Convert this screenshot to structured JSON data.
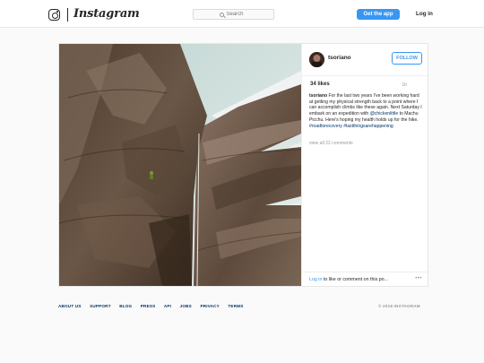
{
  "header": {
    "brand": "Instagram",
    "search_placeholder": "Search",
    "get_app_label": "Get the app",
    "login_label": "Log in"
  },
  "post": {
    "username": "tsoriano",
    "follow_label": "FOLLOW",
    "likes": "34 likes",
    "age": "1h",
    "caption": {
      "username": "tsoriano",
      "text_1": " For the last two years I've been working hard at getting my physical strength back to a point where I can accomplish climbs like these again. Next Saturday I embark on an expedition with ",
      "mention": "@chickenlittle",
      "text_2": " to Machu Picchu. Here's hoping my health holds up for the hike. ",
      "tag_1": "#roadtorecovery",
      "tag_2": "#lastthingsarehappening"
    },
    "view_all_comments": "view all 22 comments",
    "comment_prompt": {
      "link": "Log in",
      "text": " to like or comment on this po..."
    },
    "more_icon": "more-options-icon"
  },
  "footer": {
    "links": [
      "ABOUT US",
      "SUPPORT",
      "BLOG",
      "PRESS",
      "API",
      "JOBS",
      "PRIVACY",
      "TERMS"
    ],
    "copyright": "© 2018 INSTAGRAM"
  },
  "colors": {
    "accent": "#3897f0",
    "link_dark": "#003569",
    "background": "#fafafa"
  }
}
